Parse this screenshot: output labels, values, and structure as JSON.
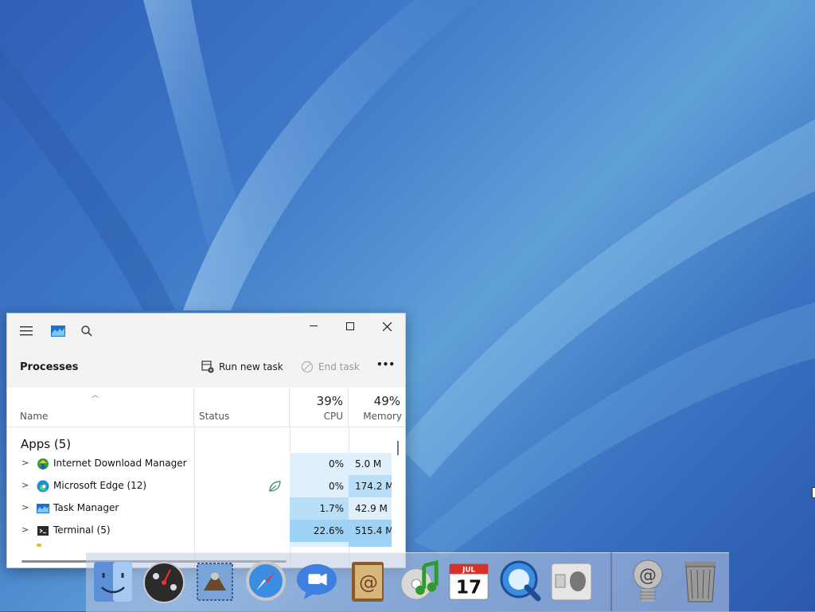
{
  "window": {
    "title_icons": [
      "hamburger-icon",
      "task-manager-icon",
      "search-icon"
    ],
    "controls": [
      "minimize",
      "maximize",
      "close"
    ]
  },
  "toolbar": {
    "title": "Processes",
    "run_new_task": "Run new task",
    "end_task": "End task",
    "more": "•••"
  },
  "columns": {
    "name": "Name",
    "status": "Status",
    "cpu": "CPU",
    "cpu_pct": "39%",
    "memory": "Memory",
    "memory_pct": "49%"
  },
  "group": {
    "title": "Apps (5)"
  },
  "rows": [
    {
      "name": "Internet Download Manager (I...",
      "status": "",
      "cpu": "0%",
      "memory": "5.0 M"
    },
    {
      "name": "Microsoft Edge (12)",
      "status": "efficiency-mode",
      "cpu": "0%",
      "memory": "174.2 M"
    },
    {
      "name": "Task Manager",
      "status": "",
      "cpu": "1.7%",
      "memory": "42.9 M"
    },
    {
      "name": "Terminal (5)",
      "status": "",
      "cpu": "22.6%",
      "memory": "515.4 M"
    }
  ],
  "colors": {
    "cpu_low": "#dff0fc",
    "cpu_mid": "#b9dff8",
    "cpu_high": "#9fd3f6",
    "accent": "#0078d4"
  },
  "dock": {
    "items": [
      "finder-icon",
      "dashboard-icon",
      "mail-icon",
      "safari-icon",
      "ichat-icon",
      "address-book-icon",
      "itunes-icon",
      "ical-icon",
      "quicktime-icon",
      "system-preferences-icon",
      "internet-connect-icon",
      "trash-icon"
    ],
    "ical_month": "JUL",
    "ical_day": "17"
  }
}
